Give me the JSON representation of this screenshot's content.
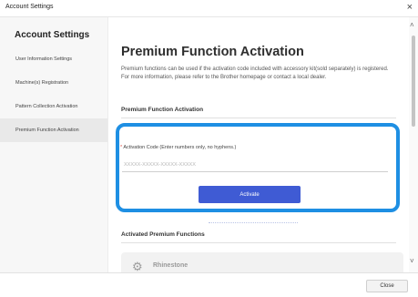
{
  "window": {
    "title": "Account Settings",
    "close_glyph": "×"
  },
  "sidebar": {
    "heading": "Account Settings",
    "items": [
      {
        "label": "User Information Settings"
      },
      {
        "label": "Machine(s) Registration"
      },
      {
        "label": "Pattern Collection Activation"
      },
      {
        "label": "Premium Function Activation",
        "selected": true
      }
    ]
  },
  "main": {
    "title": "Premium Function Activation",
    "description": "Premium functions can be used if the activation code included with accessory kit(sold separately) is registered. For more information, please refer to the Brother homepage or contact a local dealer.",
    "activation_section": {
      "title": "Premium Function Activation",
      "required_mark": "*",
      "label": "Activation Code (Enter numbers only, no hyphens.)",
      "value": "",
      "placeholder": "XXXXX-XXXXX-XXXXX-XXXXX",
      "activate_label": "Activate"
    },
    "activated_section": {
      "title": "Activated Premium Functions",
      "items": [
        {
          "name": "Rhinestone",
          "icon": "rhinestone-icon",
          "icon_glyph": "⚙"
        }
      ]
    }
  },
  "scrollbar": {
    "up_glyph": "˄",
    "down_glyph": "˅"
  },
  "footer": {
    "close_label": "Close"
  },
  "colors": {
    "accent": "#3f5bd4",
    "highlight_border": "#1e8fe3",
    "required": "#d9534f"
  }
}
